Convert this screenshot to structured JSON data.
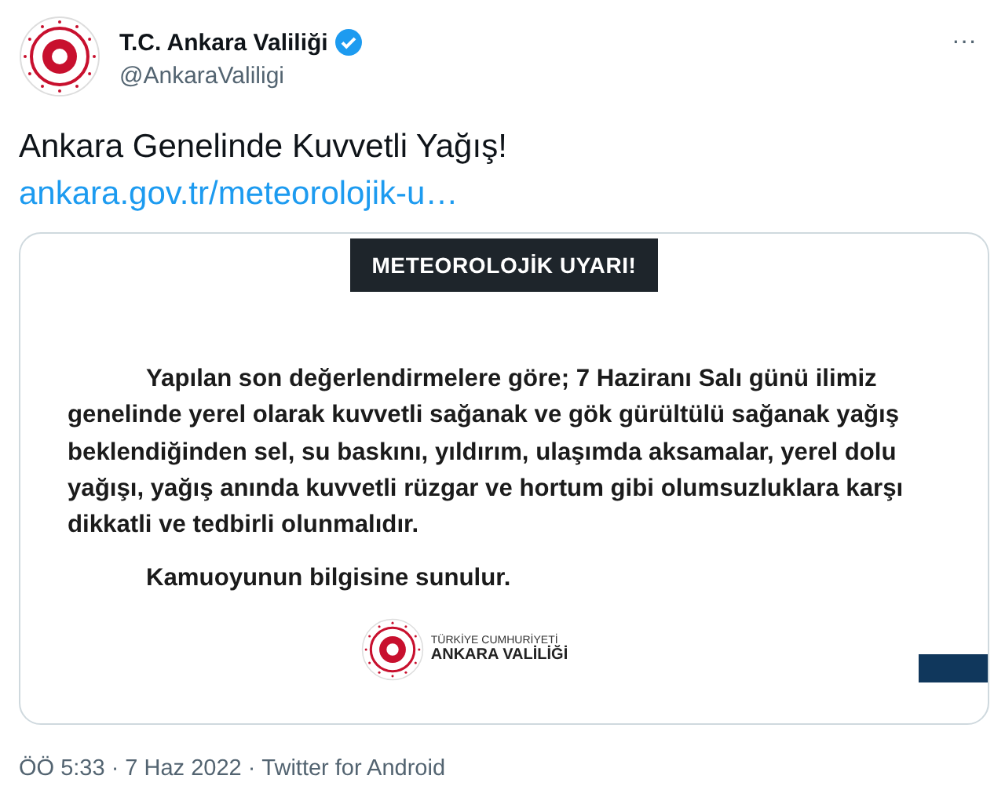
{
  "account": {
    "name": "T.C. Ankara Valiliği",
    "verified": true,
    "handle": "@AnkaraValiligi"
  },
  "more": "···",
  "tweet": {
    "text": "Ankara Genelinde Kuvvetli Yağış!",
    "link": "ankara.gov.tr/meteorolojik-u…"
  },
  "card": {
    "banner": "METEOROLOJİK UYARI!",
    "body": "Yapılan son değerlendirmelere göre; 7 Haziranı Salı günü ilimiz genelinde yerel olarak kuvvetli sağanak ve gök gürültülü sağanak yağış beklendiğinden sel, su baskını, yıldırım, ulaşımda aksamalar, yerel dolu yağışı, yağış anında kuvvetli rüzgar ve hortum gibi olumsuzluklara karşı dikkatli ve tedbirli olunmalıdır.",
    "closing": "Kamuoyunun bilgisine sunulur.",
    "org_top": "TÜRKİYE CUMHURİYETİ",
    "org_name": "ANKARA VALİLİĞİ"
  },
  "meta": {
    "time": "ÖÖ 5:33",
    "sep": "·",
    "date": "7 Haz 2022",
    "source": "Twitter for Android"
  }
}
